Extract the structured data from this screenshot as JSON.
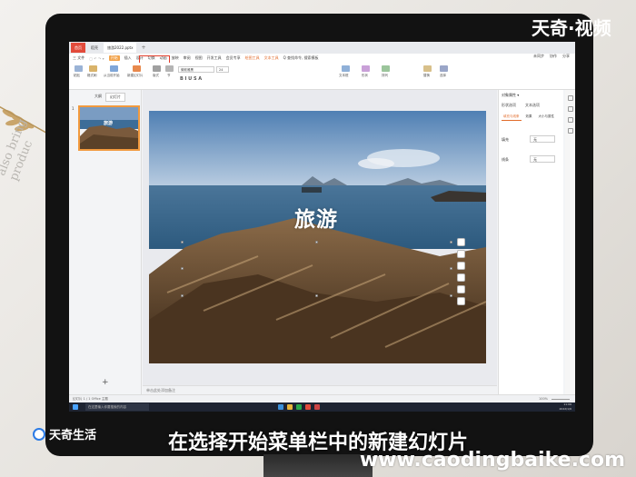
{
  "watermark_top": "天奇·视频",
  "brand_name": "天奇生活",
  "subtitle": "在选择开始菜单栏中的新建幻灯片",
  "site_url": "www.caodingbaike.com",
  "book_text": "also bring\nproduc",
  "tabs": [
    {
      "label": "首页"
    },
    {
      "label": "稻壳"
    },
    {
      "label": "旅游2022.pptx"
    }
  ],
  "menu": {
    "file": "三 文件",
    "items": [
      "开始",
      "插入",
      "设计",
      "切换",
      "动画",
      "放映",
      "审阅",
      "视图",
      "开发工具",
      "会员专享",
      "绘图工具",
      "文本工具"
    ],
    "active_index": 0,
    "search": "Q 查找命令, 搜索模板",
    "right": [
      "未同步",
      "协作",
      "分享"
    ]
  },
  "ribbon": {
    "font_name": "微软雅黑",
    "font_size": "24",
    "labels": [
      "粘贴",
      "格式刷",
      "从当前开始",
      "新建幻灯片",
      "版式",
      "节",
      "文本框",
      "形状",
      "排列",
      "替换",
      "选择"
    ]
  },
  "left_panel": {
    "tabs": [
      "大纲",
      "幻灯片"
    ],
    "active_tab": 1,
    "slide_number": "1",
    "thumb_title": "旅游",
    "add_symbol": "+"
  },
  "slide": {
    "title": "旅游",
    "notes_placeholder": "单击此处添加备注"
  },
  "right_panel": {
    "title": "对象属性 ▾",
    "tabs": [
      "形状选项",
      "文本选项"
    ],
    "subtabs": [
      "填充与线条",
      "效果",
      "大小与属性"
    ],
    "rows": [
      {
        "label": "填充",
        "value": "无"
      },
      {
        "label": "线条",
        "value": "无"
      }
    ]
  },
  "statusbar": {
    "left": "幻灯片 1 / 1    Office 主题",
    "zoom": "100%"
  },
  "taskbar": {
    "search_placeholder": "在这里输入你要搜索的内容",
    "time": "11:06",
    "date": "2022/1/6"
  }
}
